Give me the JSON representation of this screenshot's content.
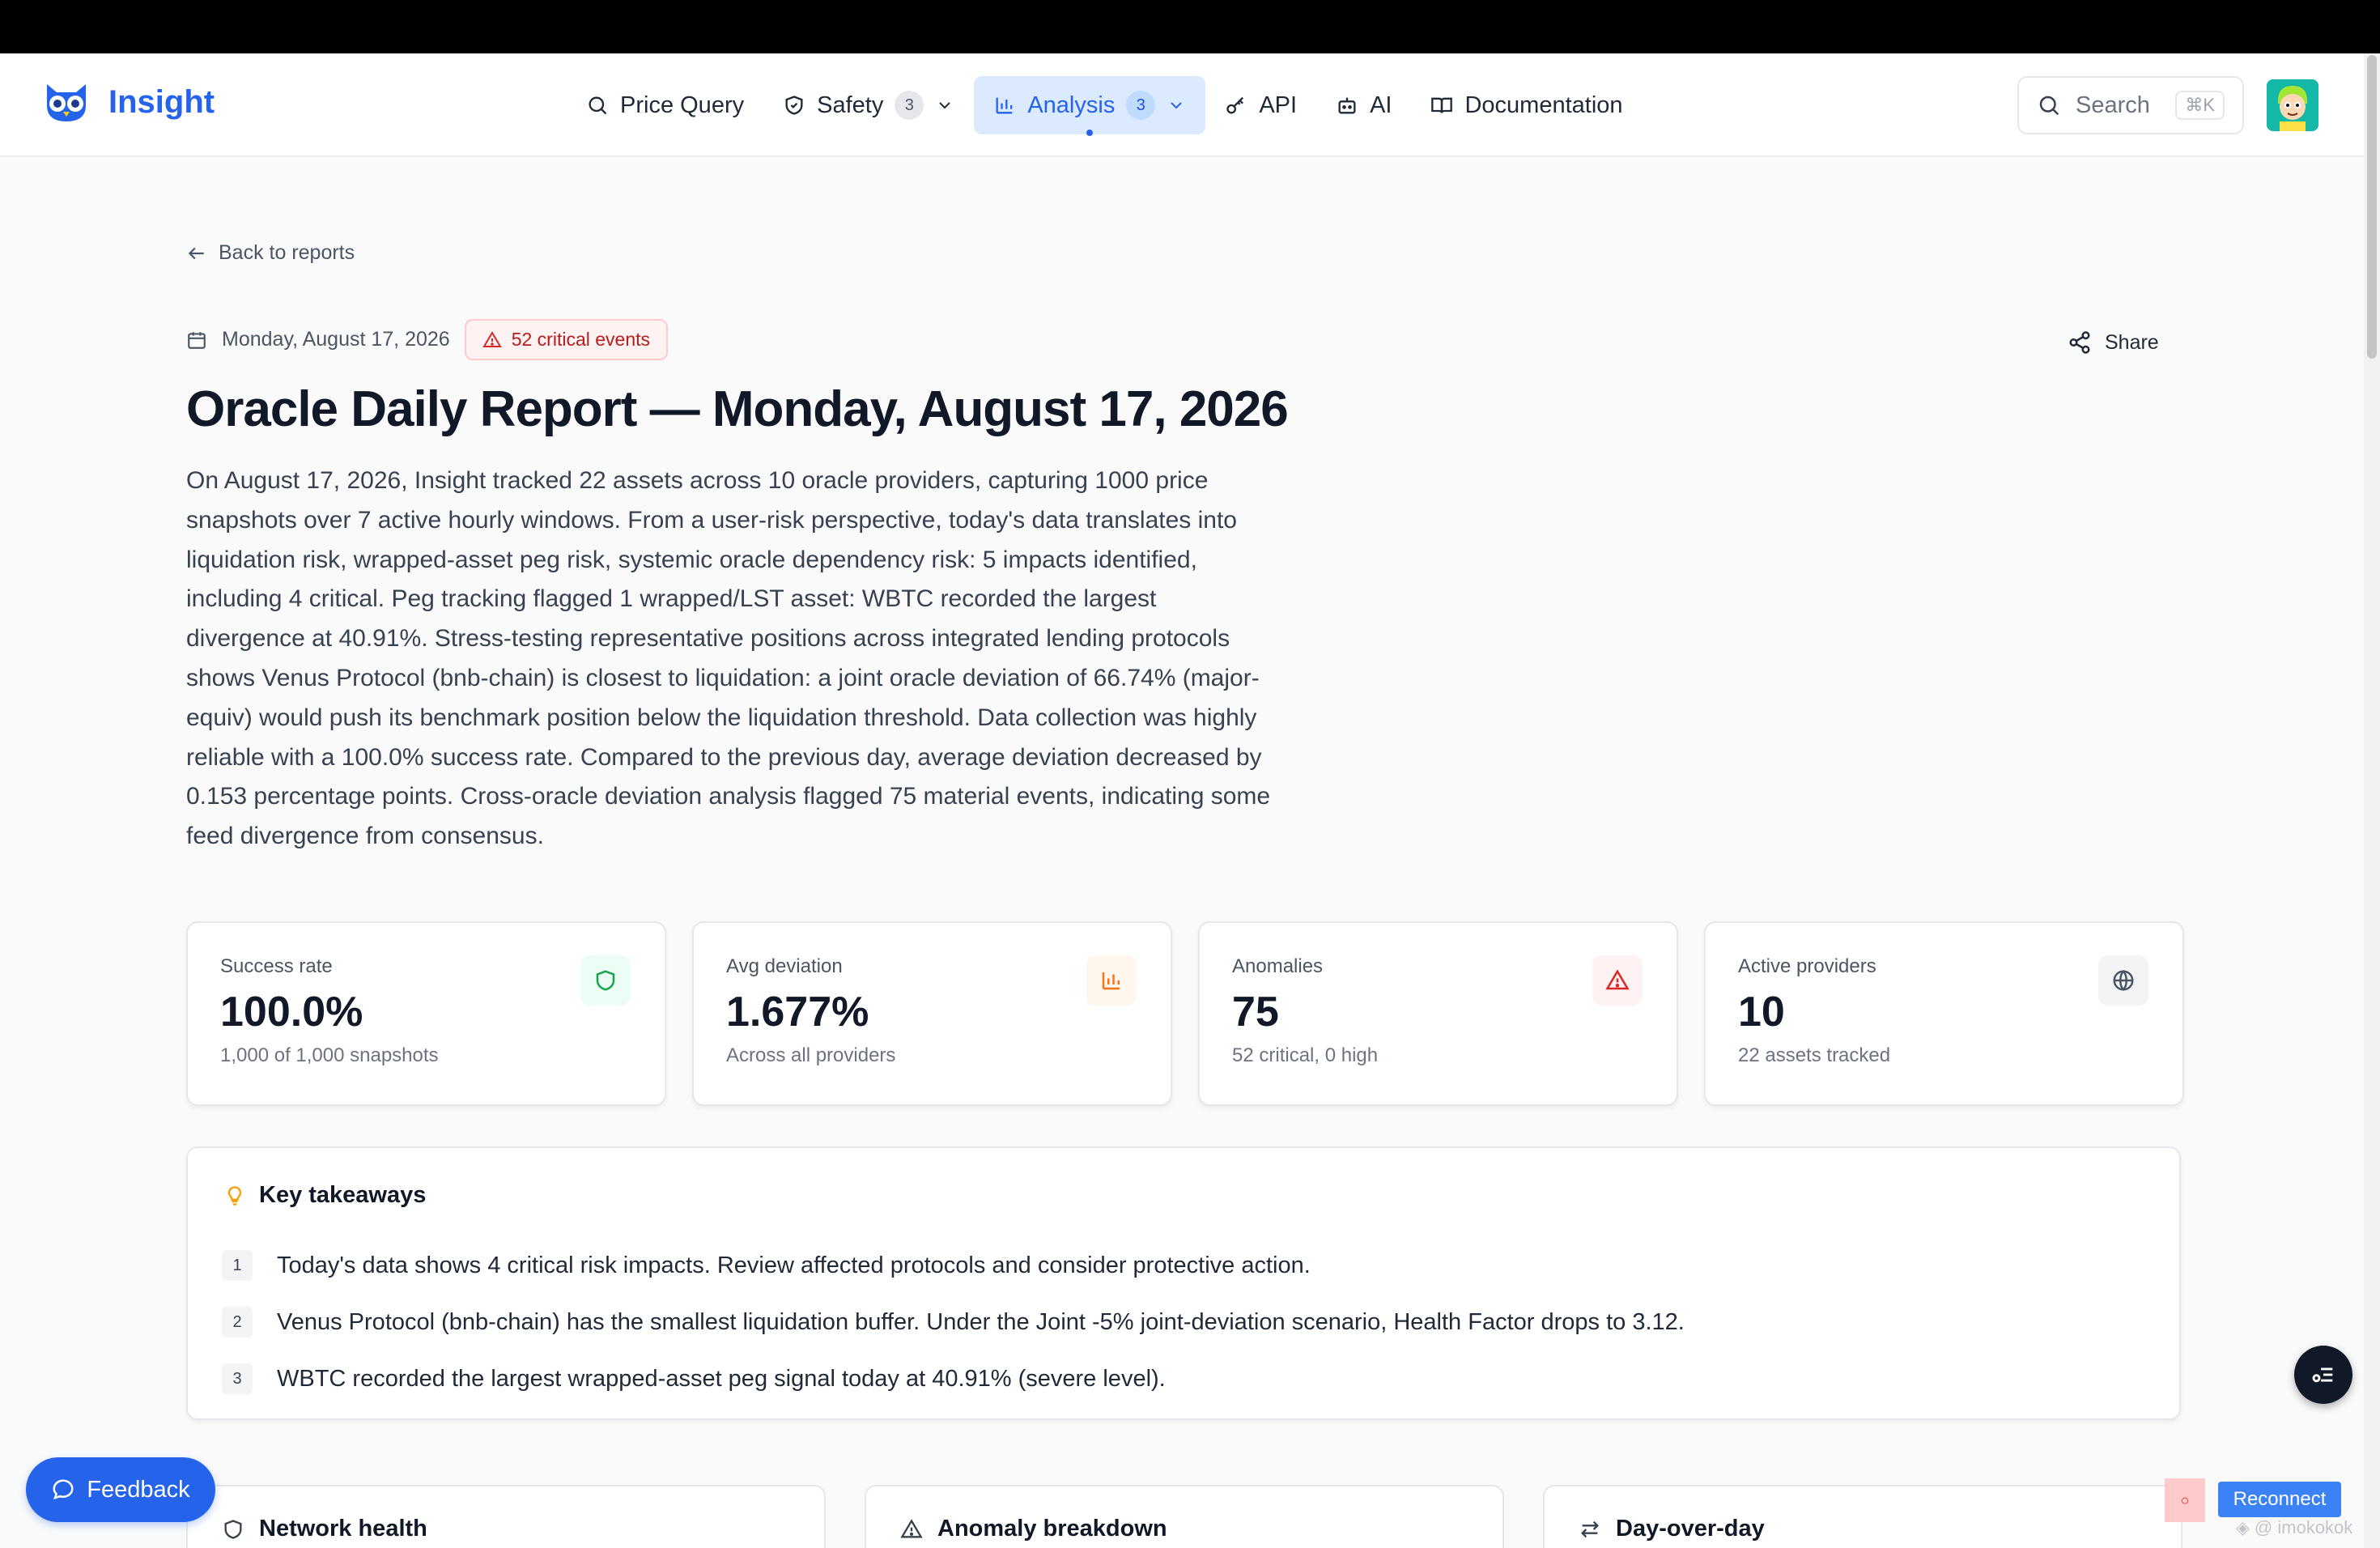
{
  "brand": {
    "name": "Insight",
    "color": "#2563eb"
  },
  "nav": [
    {
      "label": "Price Query",
      "icon": "search-icon"
    },
    {
      "label": "Safety",
      "icon": "shield-icon",
      "badge": "3"
    },
    {
      "label": "Analysis",
      "icon": "bar-chart-icon",
      "badge": "3",
      "active": true
    },
    {
      "label": "API",
      "icon": "key-icon"
    },
    {
      "label": "AI",
      "icon": "bot-icon"
    },
    {
      "label": "Documentation",
      "icon": "book-icon"
    }
  ],
  "search": {
    "label": "Search",
    "shortcut": "⌘K"
  },
  "back_link": "Back to reports",
  "report": {
    "date": "Monday, August 17, 2026",
    "critical_badge": "52 critical events",
    "share_label": "Share",
    "title": "Oracle Daily Report — Monday, August 17, 2026",
    "summary": "On August 17, 2026, Insight tracked 22 assets across 10 oracle providers, capturing 1000 price snapshots over 7 active hourly windows. From a user-risk perspective, today's data translates into liquidation risk, wrapped-asset peg risk, systemic oracle dependency risk: 5 impacts identified, including 4 critical. Peg tracking flagged 1 wrapped/LST asset: WBTC recorded the largest divergence at 40.91%. Stress-testing representative positions across integrated lending protocols shows Venus Protocol (bnb-chain) is closest to liquidation: a joint oracle deviation of 66.74% (major-equiv) would push its benchmark position below the liquidation threshold. Data collection was highly reliable with a 100.0% success rate. Compared to the previous day, average deviation decreased by 0.153 percentage points. Cross-oracle deviation analysis flagged 75 material events, indicating some feed divergence from consensus."
  },
  "stats": [
    {
      "label": "Success rate",
      "value": "100.0%",
      "sub": "1,000 of 1,000 snapshots",
      "icon": "shield-icon",
      "color": "#16a34a"
    },
    {
      "label": "Avg deviation",
      "value": "1.677%",
      "sub": "Across all providers",
      "icon": "bar-chart-icon",
      "color": "#f97316"
    },
    {
      "label": "Anomalies",
      "value": "75",
      "sub": "52 critical, 0 high",
      "icon": "alert-triangle-icon",
      "color": "#dc2626"
    },
    {
      "label": "Active providers",
      "value": "10",
      "sub": "22 assets tracked",
      "icon": "globe-icon",
      "color": "#6b7280"
    }
  ],
  "takeaways": {
    "title": "Key takeaways",
    "items": [
      {
        "num": "1",
        "text": "Today's data shows 4 critical risk impacts. Review affected protocols and consider protective action."
      },
      {
        "num": "2",
        "text": "Venus Protocol (bnb-chain) has the smallest liquidation buffer. Under the Joint -5% joint-deviation scenario, Health Factor drops to 3.12."
      },
      {
        "num": "3",
        "text": "WBTC recorded the largest wrapped-asset peg signal today at 40.91% (severe level)."
      }
    ]
  },
  "sections": [
    {
      "title": "Network health",
      "icon": "shield-icon"
    },
    {
      "title": "Anomaly breakdown",
      "icon": "alert-triangle-icon"
    },
    {
      "title": "Day-over-day",
      "icon": "arrows-swap-icon"
    }
  ],
  "feedback_label": "Feedback",
  "reconnect_label": "Reconnect",
  "status_glyph": "○",
  "watermark": "@ imokokok"
}
